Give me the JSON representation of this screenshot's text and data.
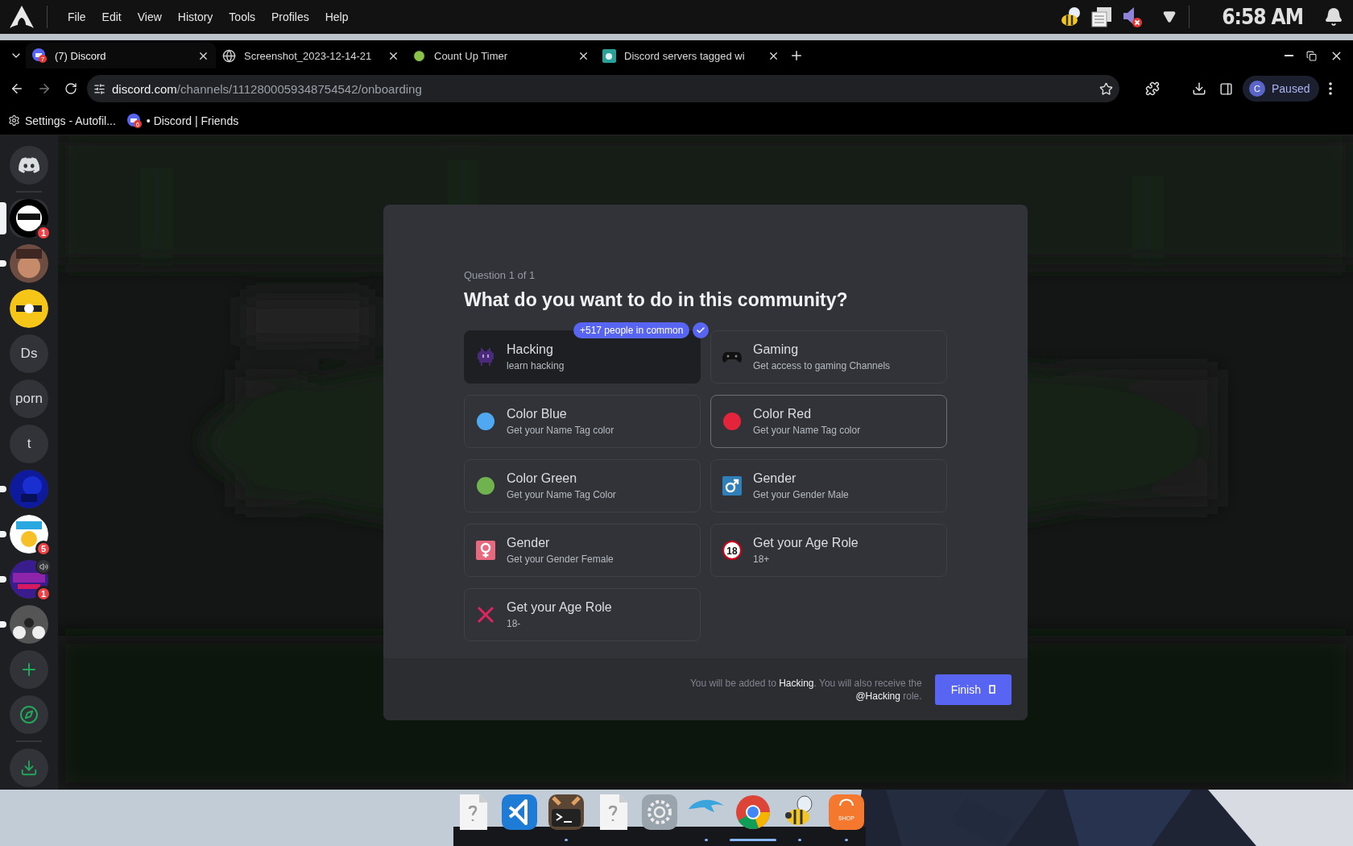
{
  "system_bar": {
    "menus": [
      "File",
      "Edit",
      "View",
      "History",
      "Tools",
      "Profiles",
      "Help"
    ],
    "clock": "6:58 AM"
  },
  "tabs": [
    {
      "kind": "discord",
      "title": "(7) Discord",
      "favicon_badge": "7",
      "selected": true
    },
    {
      "kind": "globe",
      "title": "Screenshot_2023-12-14-21",
      "selected": false
    },
    {
      "kind": "timer",
      "title": "Count Up Timer",
      "selected": false
    },
    {
      "kind": "servers",
      "title": "Discord servers tagged wi",
      "selected": false
    }
  ],
  "address": {
    "host": "discord.com",
    "path": "/channels/1112800059348754542/onboarding"
  },
  "profile": {
    "initial": "C",
    "status": "Paused"
  },
  "bookmarks": [
    {
      "kind": "settings",
      "label": "Settings - Autofil..."
    },
    {
      "kind": "discord",
      "label": "• Discord | Friends",
      "favicon_badge": "6"
    }
  ],
  "servers": [
    {
      "kind": "picture",
      "selected": true,
      "badge": "1"
    },
    {
      "kind": "picture",
      "selected": false,
      "unread": true
    },
    {
      "kind": "picture",
      "selected": false,
      "unread": false
    },
    {
      "kind": "text",
      "label": "Ds",
      "selected": false,
      "unread": false
    },
    {
      "kind": "text",
      "label": "porn",
      "selected": false,
      "unread": false
    },
    {
      "kind": "text",
      "label": "t",
      "selected": false,
      "unread": false
    },
    {
      "kind": "picture",
      "selected": false,
      "unread": true
    },
    {
      "kind": "picture",
      "selected": false,
      "unread": true,
      "badge": "5"
    },
    {
      "kind": "picture",
      "selected": false,
      "unread": true,
      "badge": "1",
      "voice": true
    },
    {
      "kind": "picture",
      "selected": false,
      "unread": true
    }
  ],
  "onboarding": {
    "step": "Question 1 of 1",
    "question": "What do you want to do in this community?",
    "options": [
      {
        "kind": "invader",
        "title": "Hacking",
        "description": "learn hacking",
        "selected": true,
        "hovered": false,
        "badge": "+517 people in common"
      },
      {
        "kind": "gamepad",
        "title": "Gaming",
        "description": "Get access to gaming Channels",
        "selected": false,
        "hovered": false
      },
      {
        "kind": "dot",
        "color": "#4fa9f0",
        "title": "Color Blue",
        "description": "Get your Name Tag color",
        "selected": false,
        "hovered": false
      },
      {
        "kind": "dot",
        "color": "#e3243b",
        "title": "Color Red",
        "description": "Get your Name Tag color",
        "selected": false,
        "hovered": true
      },
      {
        "kind": "dot",
        "color": "#6fb24e",
        "title": "Color Green",
        "description": "Get your Name Tag Color",
        "selected": false,
        "hovered": false
      },
      {
        "kind": "male",
        "title": "Gender",
        "description": "Get your Gender Male",
        "selected": false,
        "hovered": false
      },
      {
        "kind": "female",
        "title": "Gender",
        "description": "Get your Gender Female",
        "selected": false,
        "hovered": false
      },
      {
        "kind": "adult",
        "icon_text": "18",
        "title": "Get your Age Role",
        "description": "18+",
        "selected": false,
        "hovered": false
      },
      {
        "kind": "cross",
        "title": "Get your Age Role",
        "description": "18-",
        "selected": false,
        "hovered": false
      }
    ],
    "footer": "You will be added to **Hacking**. You will also receive the **@Hacking** role.",
    "finish": "Finish"
  },
  "dock": [
    {
      "kind": "file",
      "running": false
    },
    {
      "kind": "vscode",
      "running": false
    },
    {
      "kind": "terminal",
      "running": true
    },
    {
      "kind": "file",
      "running": false
    },
    {
      "kind": "settings",
      "running": false
    },
    {
      "kind": "dolphin",
      "running": true
    },
    {
      "kind": "chrome",
      "running": true,
      "active": true
    },
    {
      "kind": "bee",
      "running": true
    },
    {
      "kind": "shop",
      "label": "SHOP",
      "running": true
    }
  ]
}
